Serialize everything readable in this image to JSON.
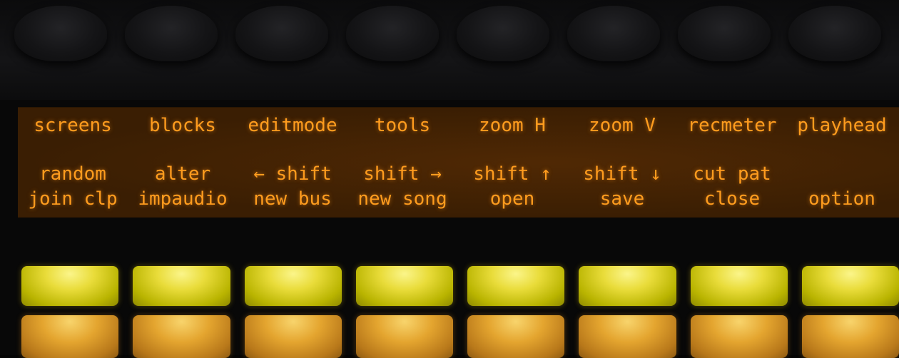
{
  "display": {
    "top_row": [
      "screens",
      "blocks",
      "editmode",
      "tools",
      "zoom H",
      "zoom V",
      "recmeter",
      "playhead"
    ],
    "middle_row": [
      "random",
      "alter",
      "← shift",
      "shift →",
      "shift ↑",
      "shift ↓",
      "cut pat",
      ""
    ],
    "bottom_row": [
      "join clp",
      "impaudio",
      "new bus",
      "new song",
      "open",
      "save",
      "close",
      "option"
    ]
  },
  "colors": {
    "lcd_background": "#3a1e03",
    "lcd_text": "#ff9c1e",
    "pad_upper": "#e9dc3a",
    "pad_lower": "#e4a52f"
  },
  "knob_count": 8,
  "pad_rows": [
    {
      "color": "yellow",
      "count": 8
    },
    {
      "color": "amber",
      "count": 8
    }
  ]
}
